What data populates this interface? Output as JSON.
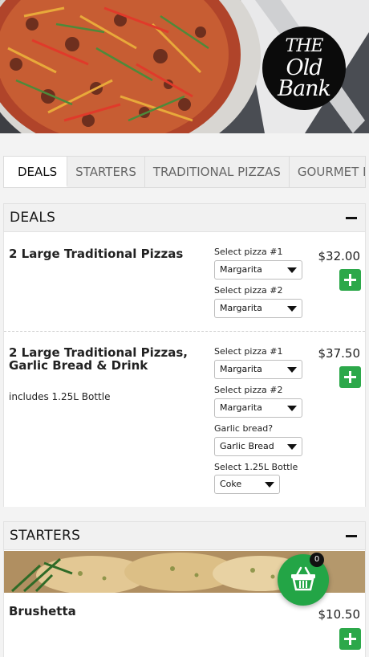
{
  "logo": {
    "line1": "THE",
    "line2": "Old",
    "line3": "Bank"
  },
  "tabs": [
    {
      "label": "DEALS"
    },
    {
      "label": "STARTERS"
    },
    {
      "label": "TRADITIONAL PIZZAS"
    },
    {
      "label": "GOURMET PIZZAS"
    }
  ],
  "sections": {
    "deals": {
      "title": "DEALS",
      "items": [
        {
          "name": "2 Large Traditional Pizzas",
          "price": "$32.00",
          "options": [
            {
              "label": "Select pizza #1",
              "value": "Margarita"
            },
            {
              "label": "Select pizza #2",
              "value": "Margarita"
            }
          ]
        },
        {
          "name_line1": "2 Large Traditional Pizzas,",
          "name_line2": "Garlic Bread & Drink",
          "description": "includes 1.25L Bottle",
          "price": "$37.50",
          "options": [
            {
              "label": "Select pizza #1",
              "value": "Margarita"
            },
            {
              "label": "Select pizza #2",
              "value": "Margarita"
            },
            {
              "label": "Garlic bread?",
              "value": "Garlic Bread"
            },
            {
              "label": "Select 1.25L Bottle",
              "value": "Coke"
            }
          ]
        }
      ]
    },
    "starters": {
      "title": "STARTERS",
      "items": [
        {
          "name": "Brushetta",
          "price": "$10.50"
        }
      ]
    }
  },
  "basket": {
    "count": "0"
  },
  "colors": {
    "accent": "#2ca84a",
    "header_bg": "#f1f1f1",
    "page_bg": "#f3f3f3"
  },
  "icons": [
    "plus-icon",
    "minus-icon",
    "basket-icon",
    "chevron-down-icon"
  ]
}
